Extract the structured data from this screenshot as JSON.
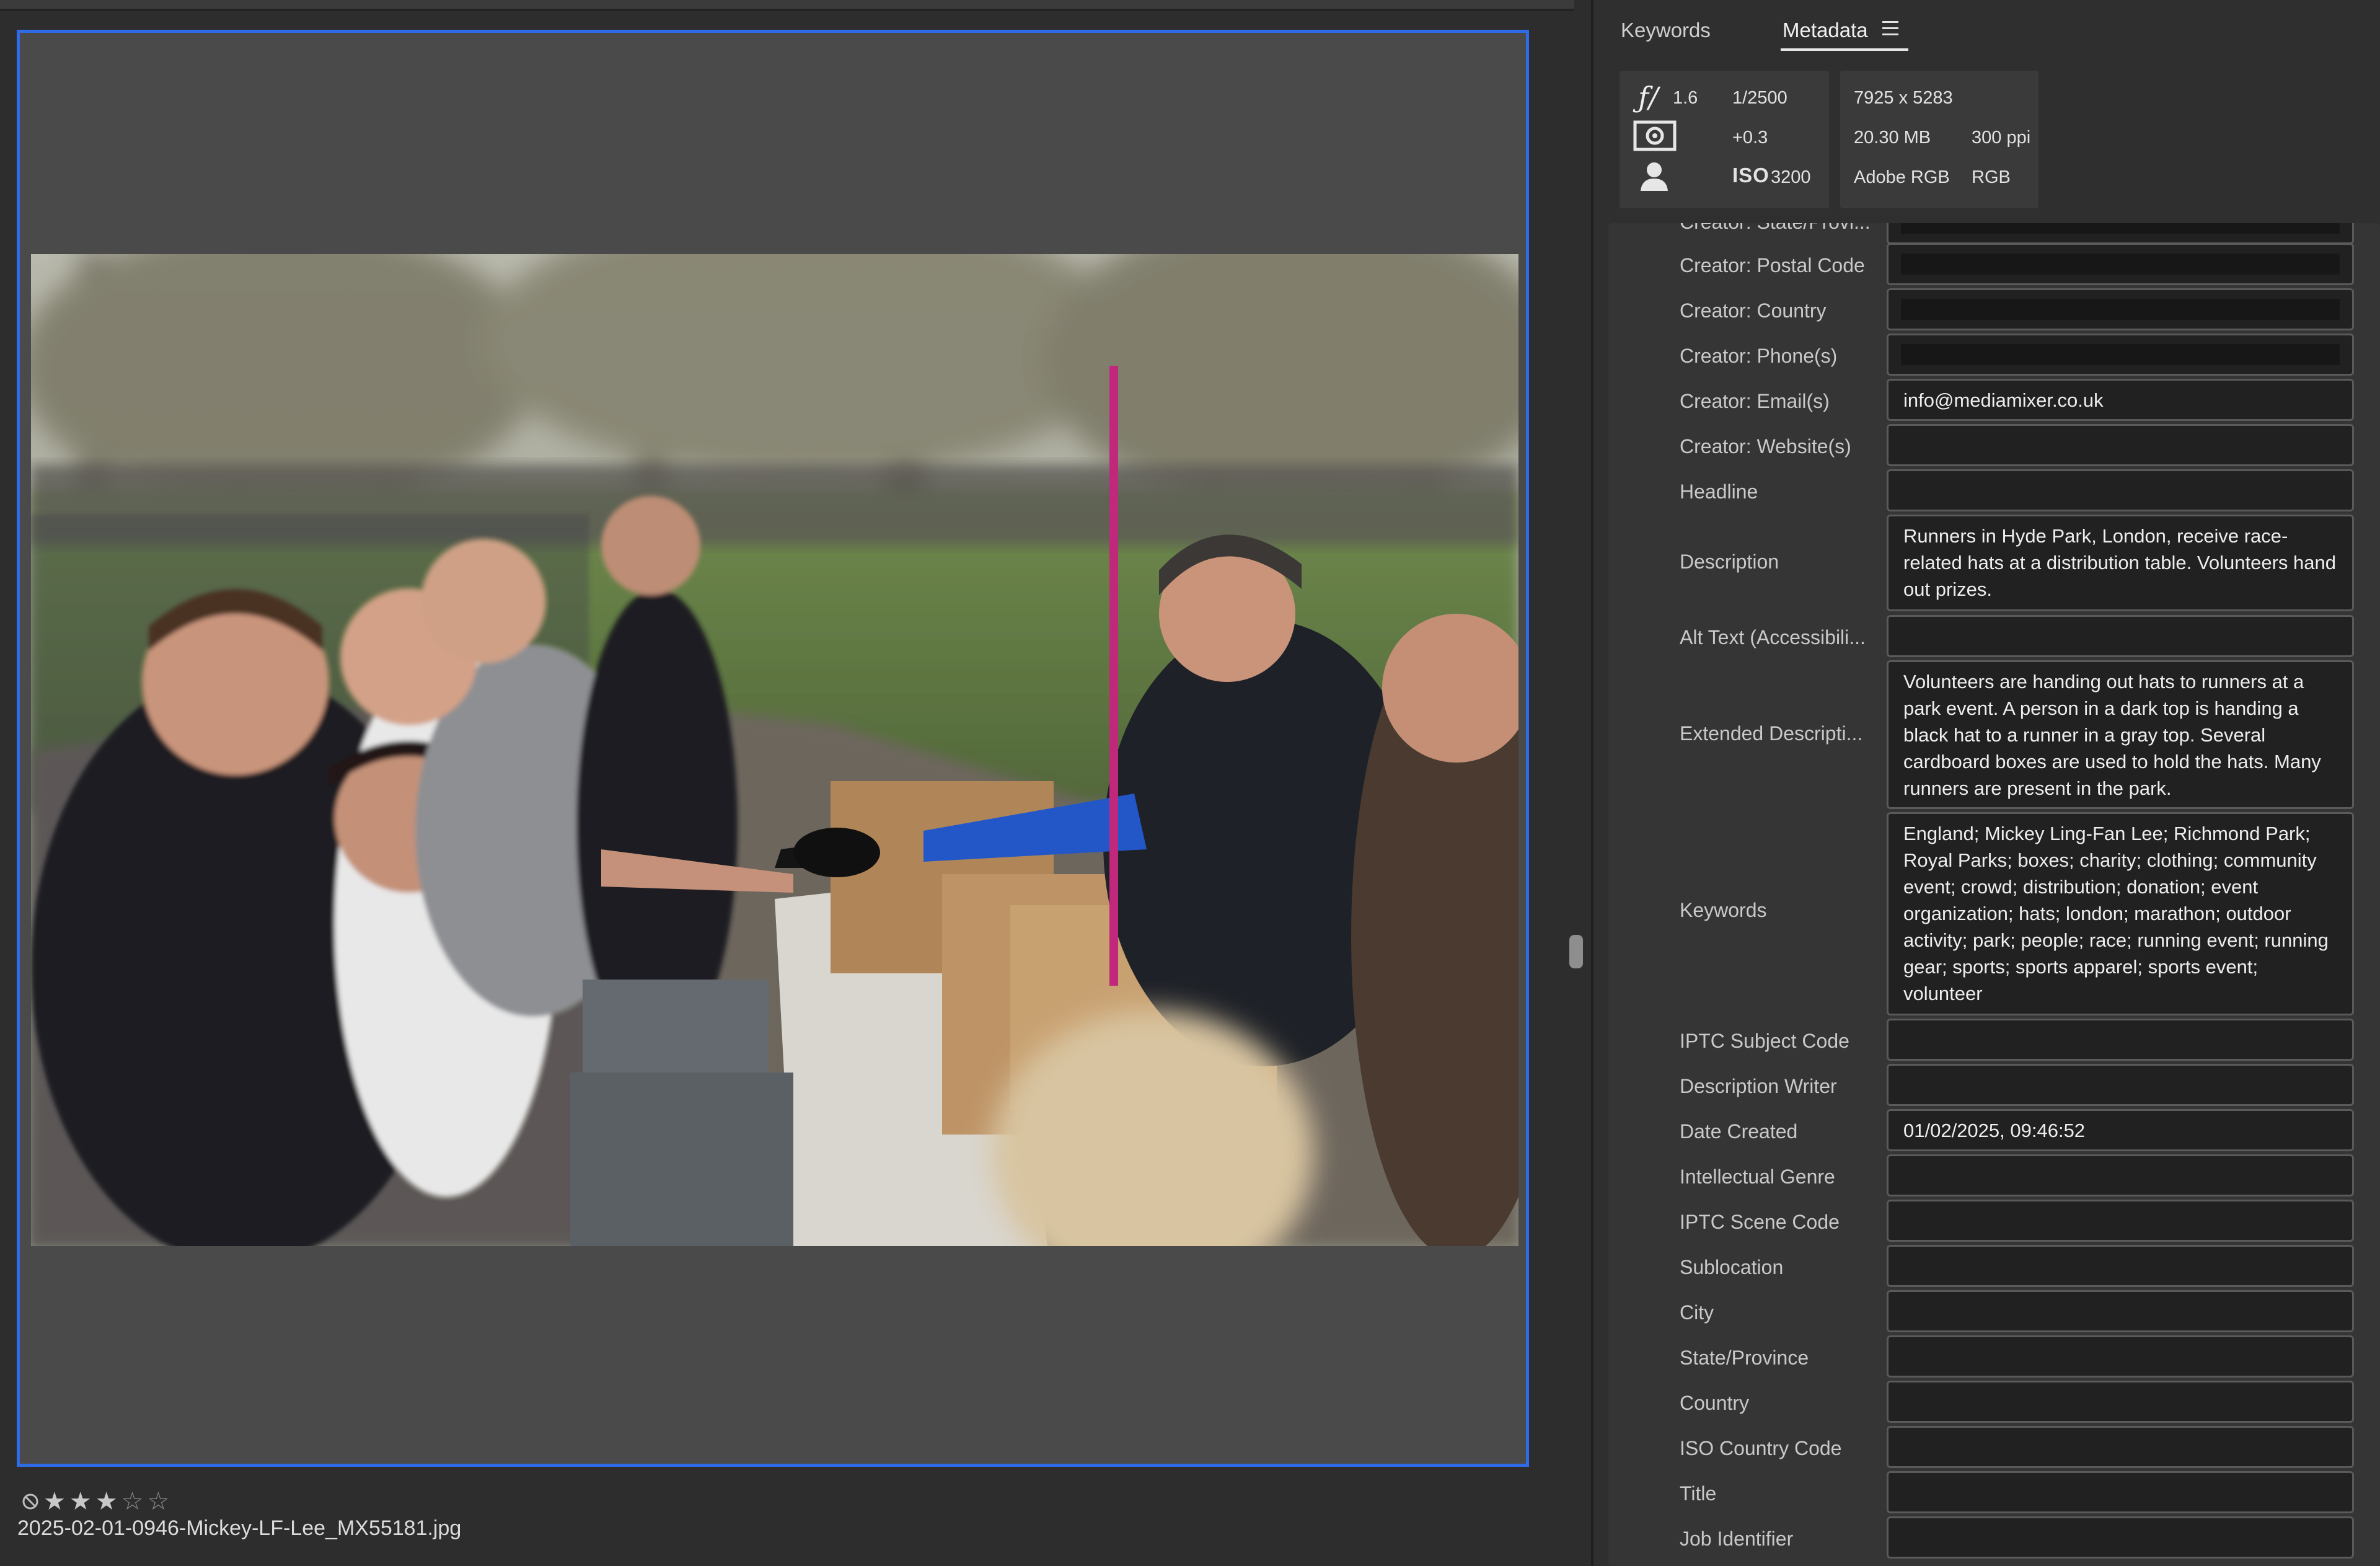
{
  "preview": {
    "rating_stars": [
      "★",
      "★",
      "★",
      "☆",
      "☆"
    ],
    "filename": "2025-02-01-0946-Mickey-LF-Lee_MX55181.jpg"
  },
  "panel": {
    "tabs": {
      "keywords": "Keywords",
      "metadata": "Metadata"
    },
    "exif": {
      "aperture_symbol": "ƒ/",
      "aperture": "1.6",
      "shutter": "1/2500",
      "exposure_comp": "+0.3",
      "iso_label": "ISO",
      "iso": "3200",
      "dimensions": "7925 x 5283",
      "file_size": "20.30 MB",
      "resolution": "300 ppi",
      "color_profile": "Adobe RGB",
      "color_mode": "RGB"
    },
    "fields": [
      {
        "label": "Creator: State/Provi...",
        "value": ""
      },
      {
        "label": "Creator: Postal Code",
        "value": ""
      },
      {
        "label": "Creator: Country",
        "value": ""
      },
      {
        "label": "Creator: Phone(s)",
        "value": ""
      },
      {
        "label": "Creator: Email(s)",
        "value": "info@mediamixer.co.uk"
      },
      {
        "label": "Creator: Website(s)",
        "value": ""
      },
      {
        "label": "Headline",
        "value": ""
      },
      {
        "label": "Description",
        "value": "Runners in Hyde Park, London, receive race-related hats at a distribution table.  Volunteers hand out prizes."
      },
      {
        "label": "Alt Text (Accessibili...",
        "value": ""
      },
      {
        "label": "Extended Descripti...",
        "value": "Volunteers are handing out hats to runners at a park event.  A person in a dark top is handing a black hat to a runner in a gray top.  Several cardboard boxes are used to hold the hats.  Many runners are present in the park."
      },
      {
        "label": "Keywords",
        "value": "England; Mickey Ling-Fan Lee; Richmond Park; Royal Parks; boxes; charity; clothing; community event; crowd; distribution; donation; event organization; hats; london; marathon; outdoor activity; park; people; race; running event; running gear; sports; sports apparel; sports event; volunteer"
      },
      {
        "label": "IPTC Subject Code",
        "value": ""
      },
      {
        "label": "Description Writer",
        "value": ""
      },
      {
        "label": "Date Created",
        "value": "01/02/2025, 09:46:52"
      },
      {
        "label": "Intellectual Genre",
        "value": ""
      },
      {
        "label": "IPTC Scene Code",
        "value": ""
      },
      {
        "label": "Sublocation",
        "value": ""
      },
      {
        "label": "City",
        "value": ""
      },
      {
        "label": "State/Province",
        "value": ""
      },
      {
        "label": "Country",
        "value": ""
      },
      {
        "label": "ISO Country Code",
        "value": ""
      },
      {
        "label": "Title",
        "value": ""
      },
      {
        "label": "Job Identifier",
        "value": ""
      }
    ]
  },
  "colors": {
    "accent_selection": "#2f6be6",
    "panel_bg": "#2f2f2f",
    "field_bg": "#212121"
  },
  "icons": [
    "reject-icon",
    "star-icon",
    "menu-icon",
    "aperture-icon",
    "metering-icon",
    "person-icon"
  ]
}
